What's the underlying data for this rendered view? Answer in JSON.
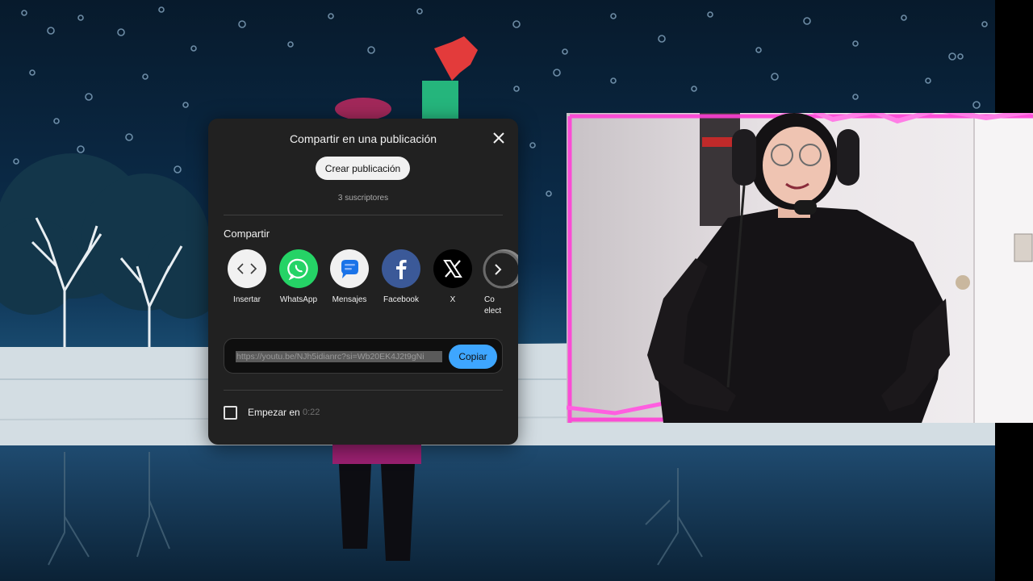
{
  "dialog": {
    "title": "Compartir en una publicación",
    "create_post_label": "Crear publicación",
    "subscribers": "3 suscriptores",
    "share_heading": "Compartir",
    "options": [
      {
        "label": "Insertar",
        "icon": "embed-icon",
        "color": "#f1f1f1"
      },
      {
        "label": "WhatsApp",
        "icon": "whatsapp-icon",
        "color": "#25d366"
      },
      {
        "label": "Mensajes",
        "icon": "messages-icon",
        "color": "#f1f1f1"
      },
      {
        "label": "Facebook",
        "icon": "facebook-icon",
        "color": "#3b5998"
      },
      {
        "label": "X",
        "icon": "x-icon",
        "color": "#000000"
      },
      {
        "label": "Co\nelect",
        "icon": "email-icon",
        "color": "#888888"
      }
    ],
    "url": "https://youtu.be/NJh5idianrc?si=Wb20EK4J2t9gNi",
    "copy_label": "Copiar",
    "start_label": "Empezar en",
    "start_time": "0:22",
    "accent_color": "#3ea6ff"
  }
}
